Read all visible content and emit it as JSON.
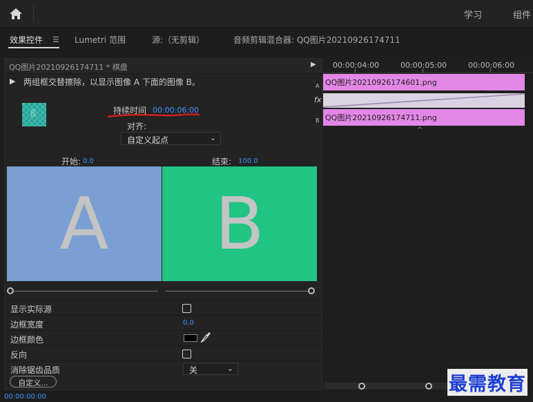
{
  "workspace": {
    "items": [
      "学习",
      "组件"
    ]
  },
  "tabs": {
    "effect_controls": "效果控件",
    "lumetri": "Lumetri 范围",
    "source": "源:（无剪辑）",
    "audio_mixer": "音频剪辑混合器: QQ图片20210926174711"
  },
  "effect_panel": {
    "clip_title": "QQ图片20210926174711 * 棋盘",
    "description": "两组框交替擦除，以显示图像 A 下面的图像 B。",
    "duration_label": "持续时间",
    "duration_value": "00:00:06:00",
    "align_label": "对齐:",
    "align_value": "自定义起点",
    "start_label": "开始:",
    "start_value": "0.0",
    "end_label": "结束:",
    "end_value": "100.0",
    "preview_a": "A",
    "preview_b": "B",
    "preview_a_color": "#7b9fd2",
    "preview_b_color": "#22c484",
    "properties": {
      "show_source": "显示实际源",
      "border_width": "边框宽度",
      "border_width_value": "0.0",
      "border_color": "边框颜色",
      "border_color_value": "#000000",
      "reverse": "反向",
      "anti_aliasing": "消除锯齿品质",
      "anti_aliasing_value": "关"
    },
    "custom_button": "自定义..."
  },
  "bottom": {
    "timecode": "00:00:00:00"
  },
  "timeline": {
    "ruler": [
      "00:00:04:00",
      "00:00:05:00",
      "00:00:06:00"
    ],
    "track_a_label": "A",
    "track_b_label": "B",
    "fx_label": "fx",
    "clip_a": "QQ图片20210926174601.png",
    "clip_b": "QQ图片20210926174711.png",
    "clip_color": "#e387e7"
  },
  "watermark": "最需教育"
}
